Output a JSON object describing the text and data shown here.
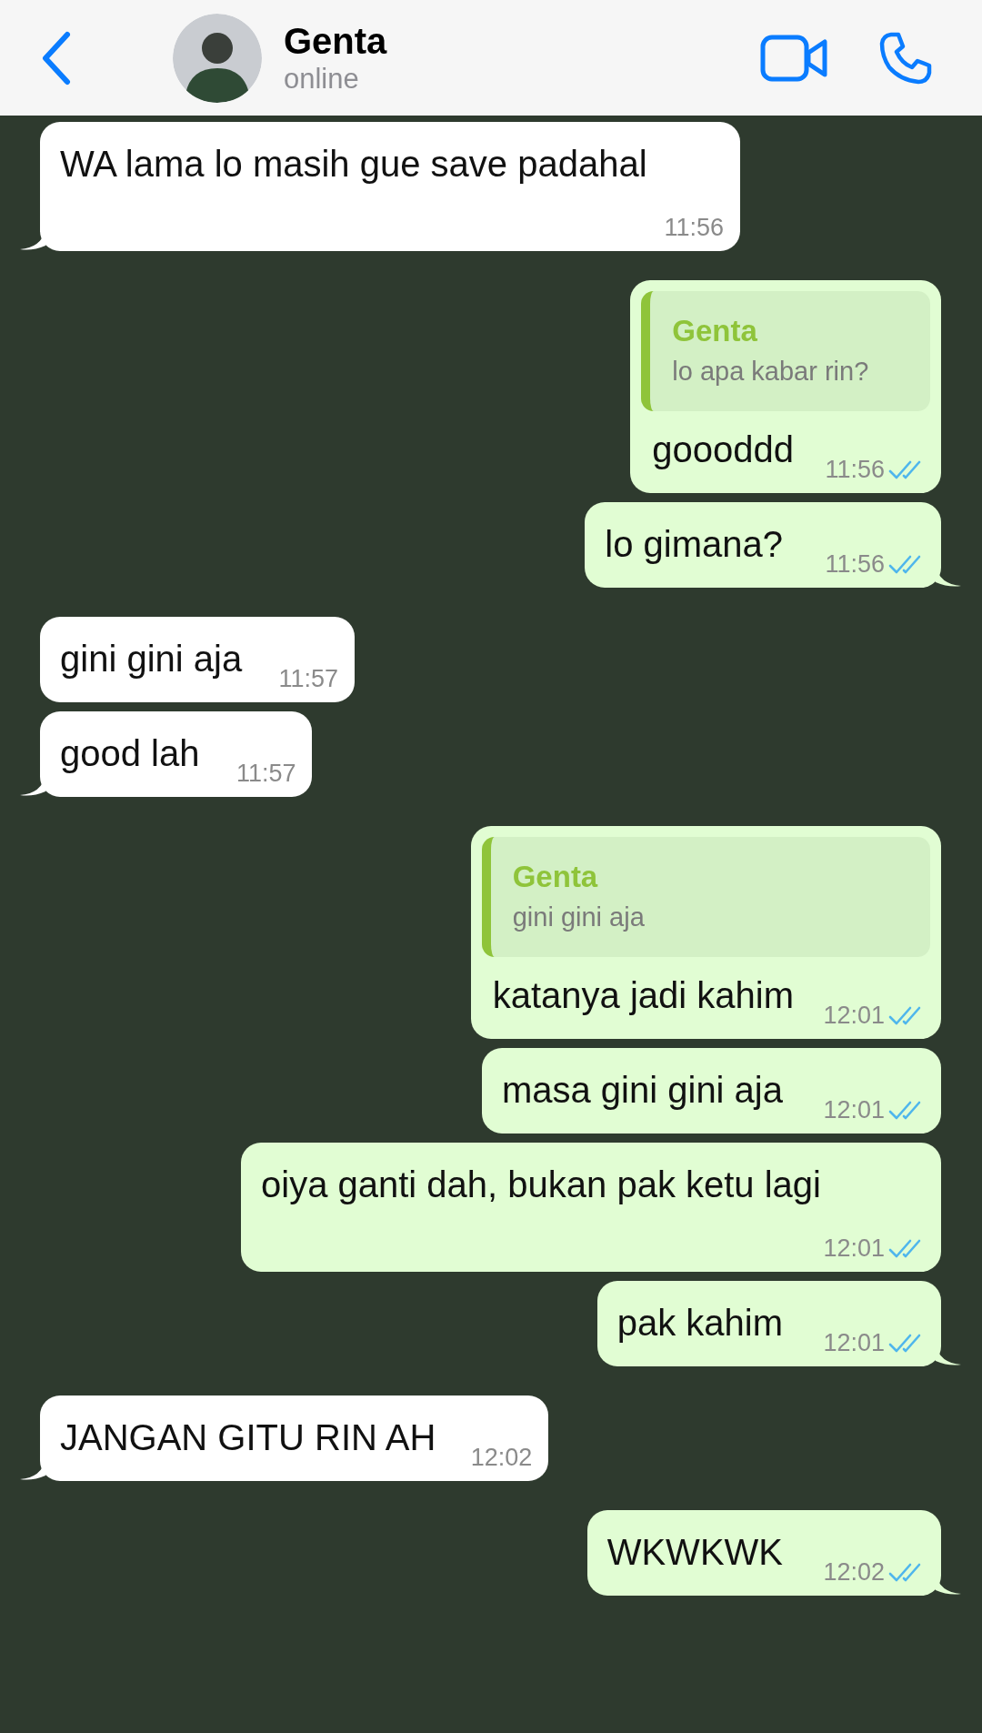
{
  "header": {
    "name": "Genta",
    "status": "online"
  },
  "messages": [
    {
      "outgoing": false,
      "text": "WA lama lo masih gue save padahal",
      "time": "11:56",
      "tail": true
    },
    {
      "outgoing": true,
      "reply": {
        "author": "Genta",
        "text": "lo apa kabar rin?"
      },
      "text": "goooddd",
      "time": "11:56",
      "tail": false,
      "read": true
    },
    {
      "outgoing": true,
      "text": "lo gimana?",
      "time": "11:56",
      "tail": true,
      "read": true
    },
    {
      "outgoing": false,
      "text": "gini gini aja",
      "time": "11:57",
      "tail": false
    },
    {
      "outgoing": false,
      "text": "good lah",
      "time": "11:57",
      "tail": true
    },
    {
      "outgoing": true,
      "reply": {
        "author": "Genta",
        "text": "gini gini aja"
      },
      "text": "katanya jadi kahim",
      "time": "12:01",
      "tail": false,
      "read": true
    },
    {
      "outgoing": true,
      "text": "masa gini gini aja",
      "time": "12:01",
      "tail": false,
      "read": true
    },
    {
      "outgoing": true,
      "text": "oiya ganti dah, bukan pak ketu lagi",
      "time": "12:01",
      "tail": false,
      "read": true
    },
    {
      "outgoing": true,
      "text": "pak kahim",
      "time": "12:01",
      "tail": true,
      "read": true
    },
    {
      "outgoing": false,
      "text": "JANGAN GITU RIN AH",
      "time": "12:02",
      "tail": true
    },
    {
      "outgoing": true,
      "text": "WKWKWK",
      "time": "12:02",
      "tail": true,
      "read": true
    }
  ]
}
